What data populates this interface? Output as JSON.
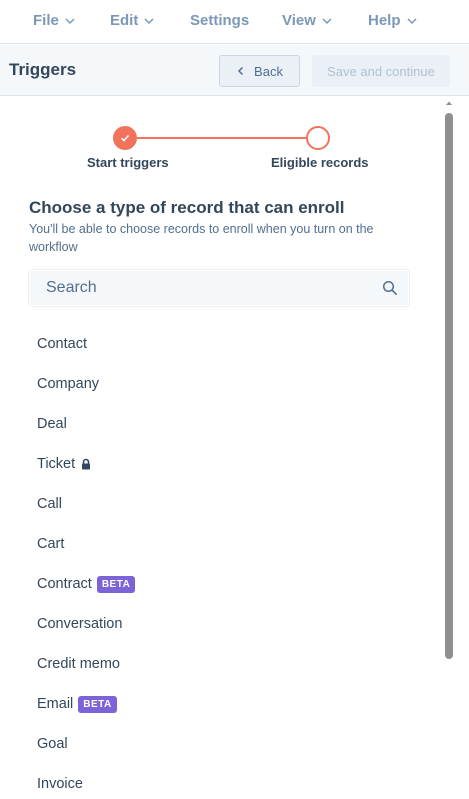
{
  "menubar": {
    "items": [
      {
        "label": "File",
        "has_dropdown": true
      },
      {
        "label": "Edit",
        "has_dropdown": true
      },
      {
        "label": "Settings",
        "has_dropdown": false
      },
      {
        "label": "View",
        "has_dropdown": true
      },
      {
        "label": "Help",
        "has_dropdown": true
      }
    ]
  },
  "header": {
    "title": "Triggers",
    "back_label": "Back",
    "save_label": "Save and continue"
  },
  "stepper": {
    "steps": [
      {
        "label": "Start triggers",
        "state": "complete"
      },
      {
        "label": "Eligible records",
        "state": "current"
      }
    ],
    "accent": "#f2735b"
  },
  "section": {
    "title": "Choose a type of record that can enroll",
    "description": "You'll be able to choose records to enroll when you turn on the workflow"
  },
  "search": {
    "placeholder": "Search",
    "value": ""
  },
  "records": [
    {
      "label": "Contact"
    },
    {
      "label": "Company"
    },
    {
      "label": "Deal"
    },
    {
      "label": "Ticket",
      "icon": "lock-icon"
    },
    {
      "label": "Call"
    },
    {
      "label": "Cart"
    },
    {
      "label": "Contract",
      "badge": "BETA"
    },
    {
      "label": "Conversation"
    },
    {
      "label": "Credit memo"
    },
    {
      "label": "Email",
      "badge": "BETA"
    },
    {
      "label": "Goal"
    },
    {
      "label": "Invoice"
    }
  ],
  "colors": {
    "badge": "#7c63d8",
    "text": "#33475b",
    "menu": "#7c98b6"
  }
}
